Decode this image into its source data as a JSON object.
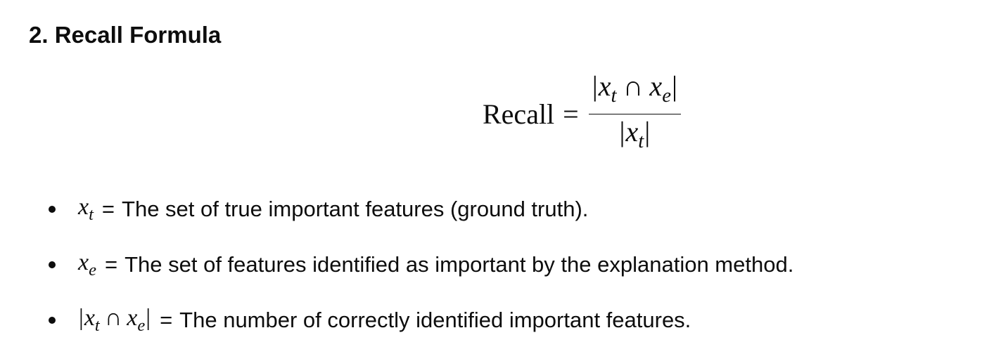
{
  "heading": "2. Recall Formula",
  "formula": {
    "lhs": "Recall",
    "relation": "=",
    "numerator": {
      "bar": "|",
      "var1": "x",
      "sub1": "t",
      "operator": "∩",
      "var2": "x",
      "sub2": "e"
    },
    "denominator": {
      "bar": "|",
      "var": "x",
      "sub": "t"
    }
  },
  "bullets": [
    {
      "symbol": {
        "var": "x",
        "sub": "t"
      },
      "equals": "=",
      "text": "The set of true important features (ground truth)."
    },
    {
      "symbol": {
        "var": "x",
        "sub": "e"
      },
      "equals": "=",
      "text": "The set of features identified as important by the explanation method."
    },
    {
      "symbol": {
        "bar": "|",
        "var1": "x",
        "sub1": "t",
        "operator": "∩",
        "var2": "x",
        "sub2": "e"
      },
      "equals": "=",
      "text": "The number of correctly identified important features."
    }
  ]
}
